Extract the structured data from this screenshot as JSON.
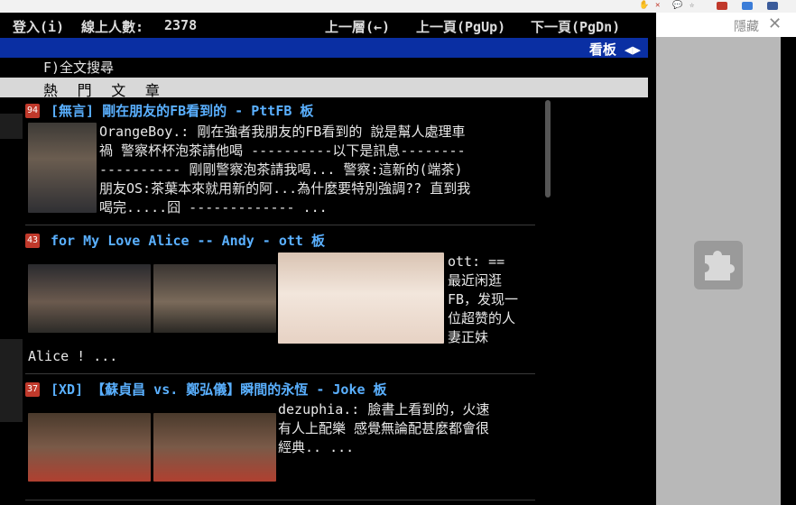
{
  "browser": {
    "extension_icons": [
      "hand-icon",
      "close-icon",
      "chat-icon",
      "star-icon",
      "flag-icon",
      "translate-icon",
      "camera-icon"
    ]
  },
  "terminal": {
    "status": {
      "login": "登入(i)",
      "online_label": "線上人數:",
      "online_count": "2378",
      "prev_level": "上一層(←)",
      "prev_page": "上一頁(PgUp)",
      "next_page": "下一頁(PgDn)"
    },
    "board_label": "看板 ◀▶",
    "search_label": "F)全文搜尋",
    "hot_section": "熱 門 文 章",
    "articles": [
      {
        "count": "94",
        "title": "[無言] 剛在朋友的FB看到的 - PttFB 板",
        "excerpt": "OrangeBoy.: 剛在強者我朋友的FB看到的 說是幫人處理車\n禍 警察杯杯泡茶請他喝 ----------以下是訊息--------\n---------- 剛剛警察泡茶請我喝... 警察:這新的(端茶)\n朋友OS:茶葉本來就用新的阿...為什麼要特別強調?? 直到我\n喝完.....囧 ------------- ..."
      },
      {
        "count": "43",
        "title": "for My Love Alice -- Andy - ott 板",
        "excerpt": "ott: ==\n最近闲逛\nFB，发现一\n位超赞的人\n妻正妹",
        "excerpt_tail": "Alice ! ..."
      },
      {
        "count": "37",
        "title": "[XD] 【蘇貞昌 vs. 鄭弘儀】瞬間的永恆 - Joke 板",
        "excerpt": "dezuphia.: 臉書上看到的，火速\n有人上配樂 感覺無論配甚麼都會很\n經典.. ..."
      }
    ]
  },
  "sidebar": {
    "hide_label": "隱藏",
    "close_symbol": "✕"
  }
}
